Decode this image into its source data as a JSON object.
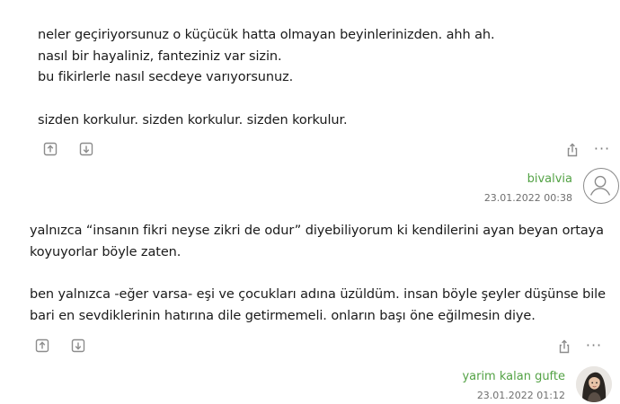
{
  "entries": [
    {
      "paragraphs": [
        "neler geçiriyorsunuz o küçücük hatta olmayan beyinlerinizden. ahh ah.\nnasıl bir hayaliniz, fanteziniz var sizin.\nbu fikirlerle nasıl secdeye varıyorsunuz.",
        "sizden korkulur. sizden korkulur. sizden korkulur."
      ],
      "author": "bivalvia",
      "date": "23.01.2022 00:38",
      "more_label": "···"
    },
    {
      "paragraphs": [
        "yalnızca “insanın fikri neyse zikri de odur” diyebiliyorum ki kendilerini ayan beyan ortaya koyuyorlar böyle zaten.",
        "ben yalnızca -eğer varsa- eşi ve çocukları adına üzüldüm. insan böyle şeyler düşünse bile bari en sevdiklerinin hatırına dile getirmemeli. onların başı öne eğilmesin diye."
      ],
      "author": "yarim kalan gufte",
      "date": "23.01.2022 01:12",
      "more_label": "···"
    }
  ],
  "icons": {
    "upvote": "arrow-up-in-box-icon",
    "downvote": "arrow-down-in-box-icon",
    "share": "share-icon",
    "more": "more-dots-icon",
    "default_avatar": "default-user-avatar-icon",
    "photo_avatar": "user-photo-avatar"
  },
  "colors": {
    "author_name": "#53a245",
    "text": "#1a1a1a",
    "meta": "#6f6f6f",
    "icon": "#8c8c8c"
  }
}
